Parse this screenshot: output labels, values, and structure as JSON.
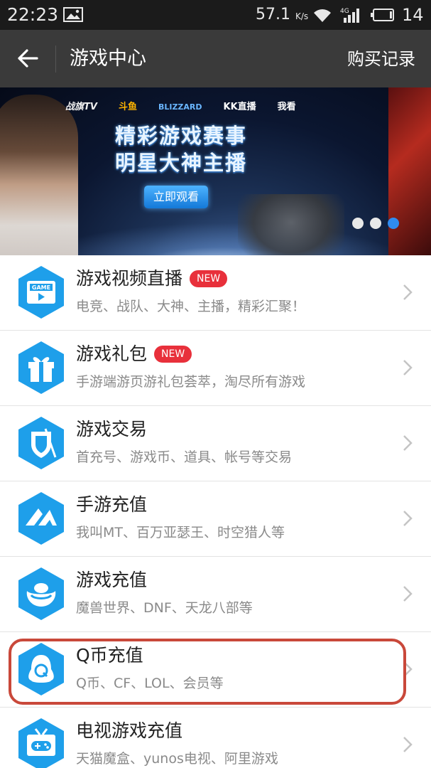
{
  "status_bar": {
    "time": "22:23",
    "net_speed": "57.1",
    "net_unit": "K/s",
    "network_type": "4G",
    "battery_level": "14"
  },
  "header": {
    "title": "游戏中心",
    "right_action": "购买记录"
  },
  "banner": {
    "logos": [
      "战旗TV",
      "斗鱼",
      "BLIZZARD",
      "KK直播",
      "我看"
    ],
    "headline_line1": "精彩游戏赛事",
    "headline_line2": "明星大神主播",
    "button_label": "立即观看",
    "dots": 3,
    "active_dot": 3
  },
  "badge_text": "NEW",
  "items": [
    {
      "title": "游戏视频直播",
      "subtitle": "电竞、战队、大神、主播，精彩汇聚！",
      "badge": true,
      "icon": "game-video-icon"
    },
    {
      "title": "游戏礼包",
      "subtitle": "手游端游页游礼包荟萃，淘尽所有游戏",
      "badge": true,
      "icon": "gift-icon"
    },
    {
      "title": "游戏交易",
      "subtitle": "首充号、游戏币、道具、帐号等交易",
      "badge": false,
      "icon": "shield-sword-icon"
    },
    {
      "title": "手游充值",
      "subtitle": "我叫MT、百万亚瑟王、时空猎人等",
      "badge": false,
      "icon": "mobile-game-icon"
    },
    {
      "title": "游戏充值",
      "subtitle": "魔兽世界、DNF、天龙八部等",
      "badge": false,
      "icon": "gold-ingot-icon"
    },
    {
      "title": "Q币充值",
      "subtitle": "Q币、CF、LOL、会员等",
      "badge": false,
      "icon": "penguin-q-icon"
    },
    {
      "title": "电视游戏充值",
      "subtitle": "天猫魔盒、yunos电视、阿里游戏",
      "badge": false,
      "icon": "tv-gamepad-icon"
    }
  ],
  "colors": {
    "status_bar_bg": "#1b1b1b",
    "title_bar_bg": "#3a3a3a",
    "icon_blue": "#1e9fea",
    "badge_red": "#e8303b",
    "highlight_red": "#c9483a",
    "active_dot": "#2f8bf0"
  }
}
